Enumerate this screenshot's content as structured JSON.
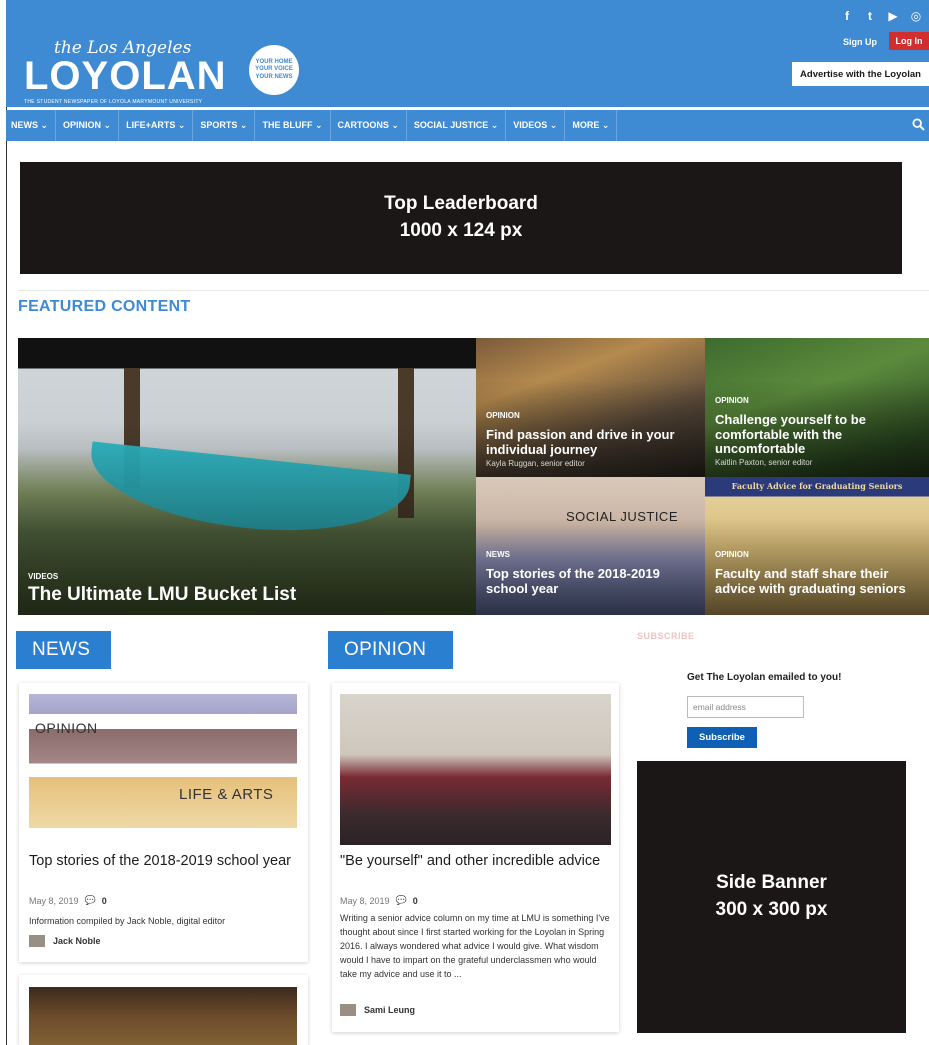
{
  "header": {
    "logo_script": "the Los Angeles",
    "logo_name": "LOYOLAN",
    "logo_tagline": "THE STUDENT NEWSPAPER OF LOYOLA MARYMOUNT UNIVERSITY",
    "badge_text": "YOUR HOME YOUR VOICE YOUR NEWS",
    "social": [
      "f",
      "t",
      "▶",
      "◎"
    ],
    "signup_label": "Sign Up",
    "login_label": "Log In",
    "advertise_label": "Advertise with the Loyolan",
    "brand_color": "#3f8bd3",
    "login_color": "#d12f2f"
  },
  "nav": {
    "items": [
      "NEWS ⌄",
      "OPINION ⌄",
      "LIFE+ARTS ⌄",
      "SPORTS ⌄",
      "THE BLUFF ⌄",
      "CARTOONS ⌄",
      "SOCIAL JUSTICE ⌄",
      "VIDEOS ⌄",
      "MORE ⌄"
    ],
    "search_icon": "search-icon"
  },
  "leaderboard": {
    "line1": "Top Leaderboard",
    "line2": "1000 x 124 px"
  },
  "featured": {
    "label": "FEATURED CONTENT",
    "main": {
      "category": "VIDEOS",
      "title": "The Ultimate LMU Bucket List"
    },
    "tiles": [
      {
        "category": "OPINION",
        "title": "Find passion and drive in your individual journey",
        "byline": "Kayla Ruggan, senior editor"
      },
      {
        "category": "OPINION",
        "title": "Challenge yourself to be comfortable with the uncomfortable",
        "byline": "Kaitlin Paxton, senior editor"
      },
      {
        "category": "NEWS",
        "title": "Top stories of the 2018-2019 school year",
        "byline": "",
        "image_word": "SOCIAL JUSTICE"
      },
      {
        "category": "OPINION",
        "title": "Faculty and staff share their advice with graduating seniors",
        "byline": "",
        "banner": "Faculty Advice for Graduating Seniors"
      }
    ]
  },
  "news": {
    "heading": "NEWS",
    "card": {
      "image_words": [
        "OPINION",
        "LIFE & ARTS"
      ],
      "title": "Top stories of the 2018-2019 school year",
      "date": "May 8, 2019",
      "comments": "0",
      "excerpt": "Information compiled by Jack Noble, digital editor",
      "author": "Jack Noble"
    }
  },
  "opinion": {
    "heading": "OPINION",
    "card": {
      "title": "\"Be yourself\" and other incredible advice",
      "date": "May 8, 2019",
      "comments": "0",
      "excerpt": "Writing a senior advice column on my time at LMU is something I've thought about since I first started working for the Loyolan in Spring 2016. I always wondered what advice I would give. What wisdom would I have to impart on the grateful underclassmen who would take my advice and use it to ...",
      "author": "Sami Leung"
    }
  },
  "subscribe": {
    "heading": "SUBSCRIBE",
    "lead": "Get The Loyolan emailed to you!",
    "placeholder": "email address",
    "button": "Subscribe"
  },
  "side_banner": {
    "line1": "Side Banner",
    "line2": "300 x 300 px"
  }
}
